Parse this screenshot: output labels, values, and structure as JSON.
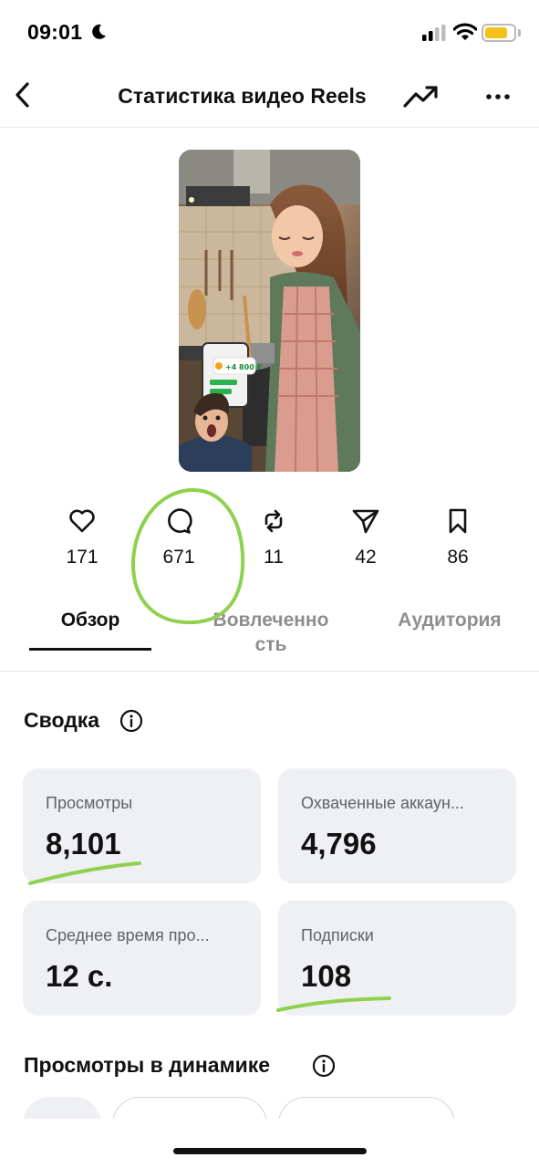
{
  "status_bar": {
    "time": "09:01",
    "battery_color": "#f3c21a"
  },
  "nav": {
    "title": "Статистика видео Reels",
    "back_icon": "chevron-left-icon",
    "trend_icon": "trending-up-icon",
    "more_icon": "more-horizontal-icon"
  },
  "metrics": [
    {
      "icon": "heart-icon",
      "value": "171"
    },
    {
      "icon": "comment-icon",
      "value": "671"
    },
    {
      "icon": "repost-icon",
      "value": "11"
    },
    {
      "icon": "send-icon",
      "value": "42"
    },
    {
      "icon": "bookmark-icon",
      "value": "86"
    }
  ],
  "tabs": {
    "overview": "Обзор",
    "engagement_line1": "Вовлеченно",
    "engagement_line2": "сть",
    "audience": "Аудитория"
  },
  "summary": {
    "title": "Сводка",
    "cards": [
      {
        "label": "Просмотры",
        "value": "8,101"
      },
      {
        "label": "Охваченные аккаун...",
        "value": "4,796"
      },
      {
        "label": "Среднее время про...",
        "value": "12 с."
      },
      {
        "label": "Подписки",
        "value": "108"
      }
    ]
  },
  "views_dynamics": {
    "title": "Просмотры в динамике"
  },
  "colors": {
    "annotation": "#8fd14f",
    "card_bg": "#eff0f3"
  }
}
